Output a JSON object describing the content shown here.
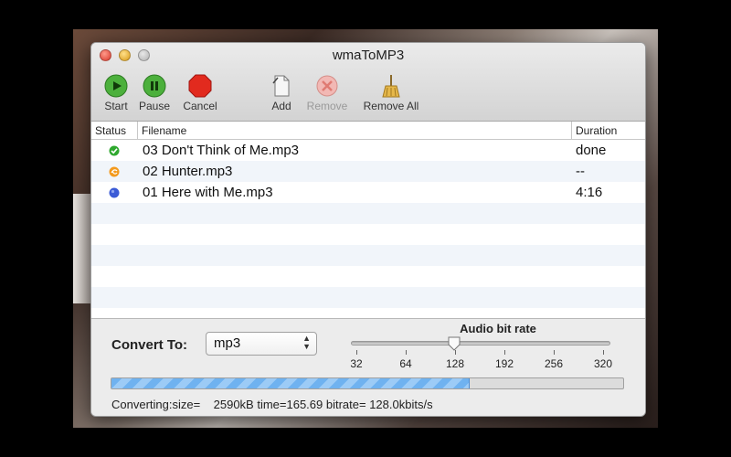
{
  "window": {
    "title": "wmaToMP3"
  },
  "toolbar": {
    "start_label": "Start",
    "pause_label": "Pause",
    "cancel_label": "Cancel",
    "add_label": "Add",
    "remove_label": "Remove",
    "remove_all_label": "Remove All"
  },
  "table": {
    "headers": {
      "status": "Status",
      "filename": "Filename",
      "duration": "Duration"
    },
    "rows": [
      {
        "status_icon": "check-icon",
        "filename": "03 Don't Think of Me.mp3",
        "duration": "done"
      },
      {
        "status_icon": "converting-icon",
        "filename": "02 Hunter.mp3",
        "duration": "--"
      },
      {
        "status_icon": "pending-icon",
        "filename": "01 Here with Me.mp3",
        "duration": "4:16"
      }
    ]
  },
  "convert": {
    "label": "Convert To:",
    "selected": "mp3"
  },
  "bitrate": {
    "label": "Audio bit rate",
    "ticks": [
      "32",
      "64",
      "128",
      "192",
      "256",
      "320"
    ],
    "selected": "128"
  },
  "progress": {
    "fraction": 0.7
  },
  "status": {
    "text": "Converting:size=    2590kB time=165.69 bitrate= 128.0kbits/s"
  },
  "colors": {
    "accent": "#6fb2f0",
    "done": "#2ea82e",
    "converting": "#f39a1e",
    "pending": "#3b5bd6"
  }
}
